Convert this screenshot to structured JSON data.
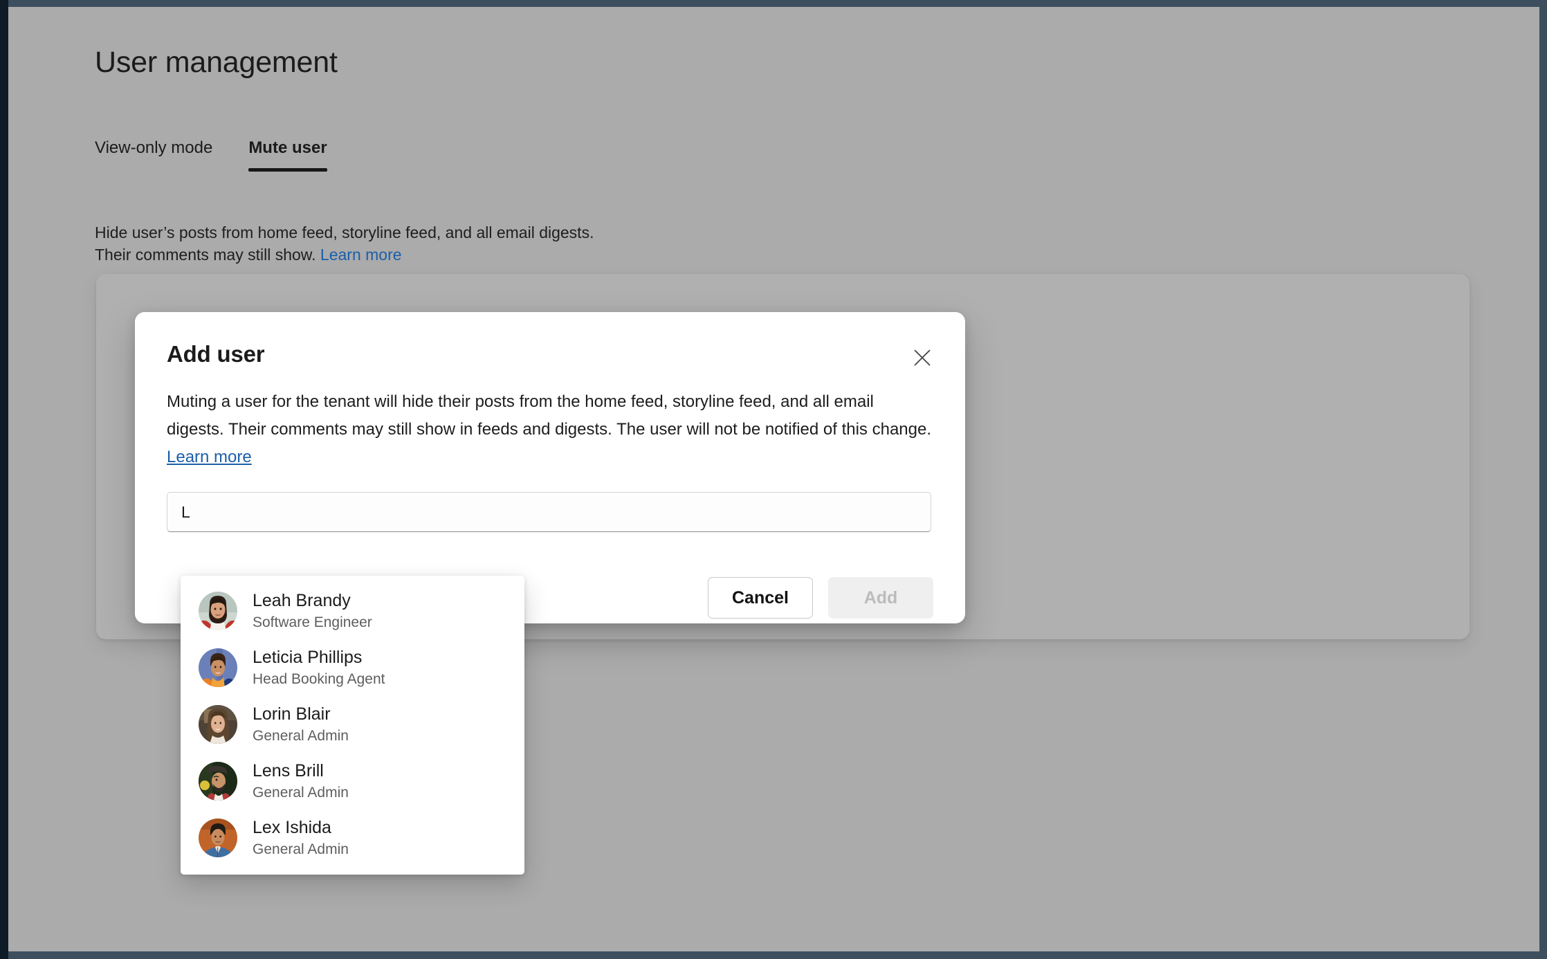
{
  "page": {
    "title": "User management",
    "tabs": [
      {
        "label": "View-only mode",
        "active": false
      },
      {
        "label": "Mute user",
        "active": true
      }
    ],
    "description_line1": "Hide user’s posts from home feed, storyline feed, and all email digests.",
    "description_line2_prefix": "Their comments may still show. ",
    "description_link": "Learn more"
  },
  "dialog": {
    "title": "Add user",
    "close_icon": "close-icon",
    "body_text": "Muting a user for the tenant will hide their posts from the home feed, storyline feed, and all email digests. Their comments may still show in feeds and digests. The user will not be notified of this change. ",
    "body_link": "Learn more",
    "search": {
      "value": "L",
      "placeholder": ""
    },
    "cancel_label": "Cancel",
    "add_label": "Add"
  },
  "suggestions": [
    {
      "name": "Leah Brandy",
      "role": "Software Engineer",
      "avatar": "avatar-leah-brandy"
    },
    {
      "name": "Leticia Phillips",
      "role": "Head Booking Agent",
      "avatar": "avatar-leticia-phillips"
    },
    {
      "name": "Lorin Blair",
      "role": "General Admin",
      "avatar": "avatar-lorin-blair"
    },
    {
      "name": "Lens Brill",
      "role": "General Admin",
      "avatar": "avatar-lens-brill"
    },
    {
      "name": "Lex Ishida",
      "role": "General Admin",
      "avatar": "avatar-lex-ishida"
    }
  ],
  "colors": {
    "page_background": "#ababab",
    "window_border": "#3d4f5e",
    "dialog_background": "#ffffff",
    "link": "#1a5fa8",
    "tab_indicator": "#171717",
    "disabled_button_background": "#efefef",
    "disabled_button_text": "#bbbbbb"
  }
}
